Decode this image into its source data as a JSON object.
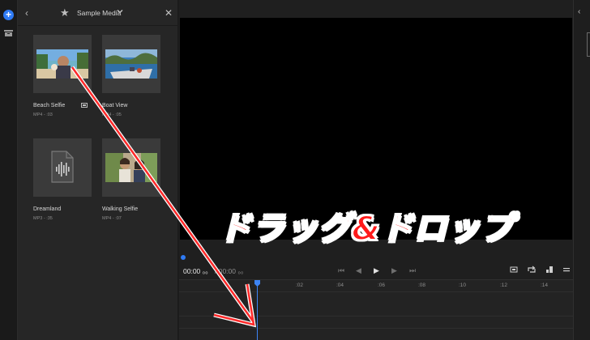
{
  "toolbar": {
    "items": [
      "add-icon",
      "library-icon"
    ]
  },
  "media_panel": {
    "back_icon": "‹",
    "favorite_icon": "★",
    "title": "Sample Media",
    "close_icon": "✕",
    "items": [
      {
        "name": "Beach Selfie",
        "meta": "MP4 - :03",
        "thumb": "beach-selfie-thumbnail"
      },
      {
        "name": "Boat View",
        "meta": "MP4 - :05",
        "thumb": "boat-view-thumbnail"
      },
      {
        "name": "Dreamland",
        "meta": "MP3 - :35",
        "thumb": "audio-file-icon"
      },
      {
        "name": "Walking Selfie",
        "meta": "MP4 - :07",
        "thumb": "walking-selfie-thumbnail"
      }
    ]
  },
  "program": {
    "timecode_current": "00:00 ₀₀",
    "timecode_total": "/ 00:00 ₀₀",
    "controls": {
      "prev": "⏮",
      "step_back": "◀",
      "play": "▶",
      "step_forward": "▶",
      "next": "⏭"
    }
  },
  "timeline": {
    "ticks": [
      ":02",
      ":04",
      ":06",
      ":08",
      ":10",
      ":12",
      ":14"
    ]
  },
  "annotation": {
    "text": "ドラッグ&ドロップ",
    "color": "#ff1a1a",
    "outline": "#ffffff"
  },
  "colors": {
    "accent": "#2f7bf5",
    "background": "#1d1d1d",
    "panel": "#262626"
  }
}
